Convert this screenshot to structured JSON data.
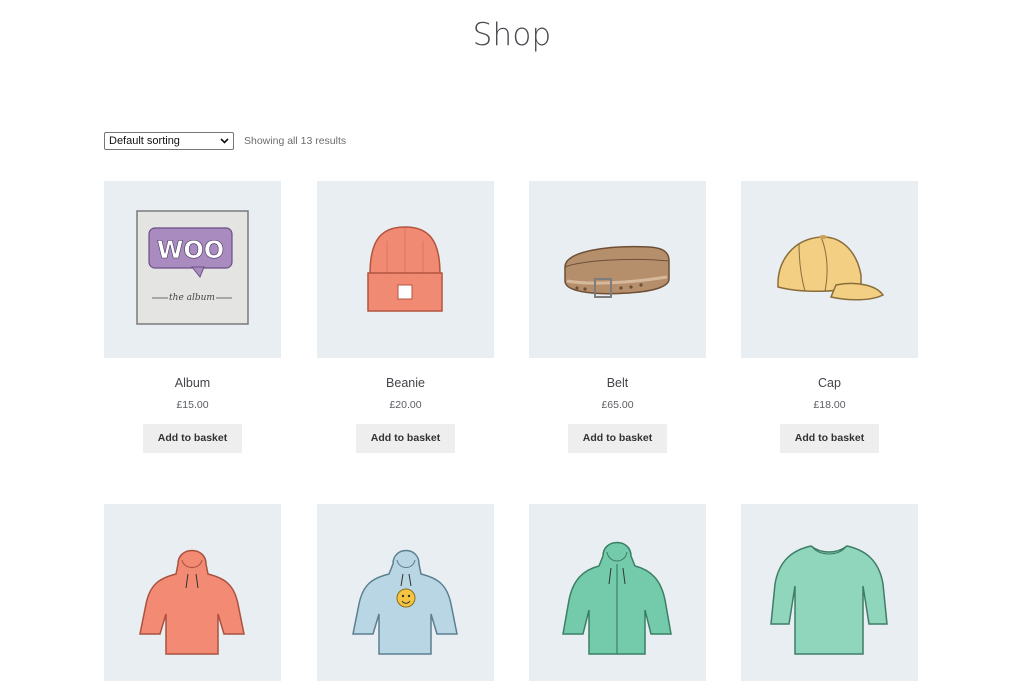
{
  "page": {
    "title": "Shop"
  },
  "toolbar": {
    "sort_selected": "Default sorting",
    "result_count": "Showing all 13 results"
  },
  "products": [
    {
      "name": "Album",
      "price": "£15.00",
      "button": "Add to basket",
      "image": "album-image",
      "woo": "WOO",
      "album_caption": "the album"
    },
    {
      "name": "Beanie",
      "price": "£20.00",
      "button": "Add to basket",
      "image": "beanie-image"
    },
    {
      "name": "Belt",
      "price": "£65.00",
      "button": "Add to basket",
      "image": "belt-image"
    },
    {
      "name": "Cap",
      "price": "£18.00",
      "button": "Add to basket",
      "image": "cap-image"
    },
    {
      "image": "hoodie-orange-image"
    },
    {
      "image": "hoodie-logo-image"
    },
    {
      "image": "hoodie-zip-image"
    },
    {
      "image": "long-sleeve-tee-image"
    }
  ],
  "colors": {
    "thumb_bg": "#e9eef3",
    "button_bg": "#eeeeee",
    "album_badge": "#a98bc0",
    "beanie": "#f08a72",
    "belt": "#b58e6c",
    "cap": "#f2cf83",
    "hoodie_orange": "#f28a74",
    "hoodie_blue": "#b9d6e4",
    "hoodie_green": "#74cbab",
    "tee": "#8fd6bd"
  }
}
